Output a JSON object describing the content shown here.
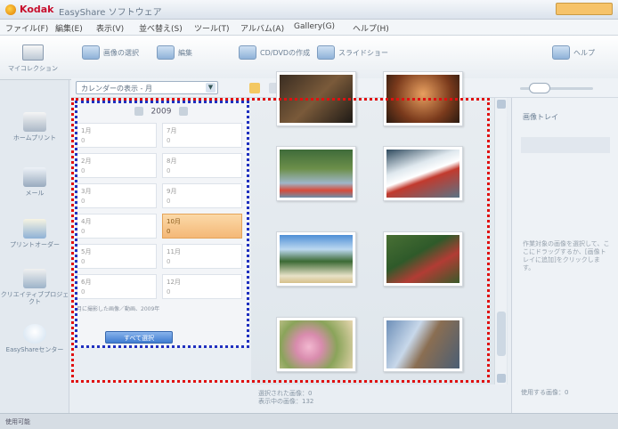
{
  "title_bar": {
    "brand": "Kodak",
    "app_title": "EasyShare ソフトウェア"
  },
  "menu": [
    "ファイル(F)",
    "編集(E)",
    "表示(V)",
    "並べ替え(S)",
    "ツール(T)",
    "アルバム(A)",
    "Gallery(G)",
    "ヘルプ(H)"
  ],
  "toolbar": {
    "select_photos": "画像の選択",
    "edit": "編集",
    "cd_dvd": "CD/DVDの作成",
    "slideshow": "スライドショー",
    "help": "ヘルプ",
    "collection": "マイコレクション"
  },
  "view_toolbar": {
    "dropdown_value": "カレンダーの表示 - 月"
  },
  "sidebar": {
    "items": [
      "ホームプリント",
      "メール",
      "プリントオーダー",
      "クリエイティブプロジェクト",
      "EasyShareセンター"
    ]
  },
  "calendar": {
    "year": "2009",
    "months": [
      {
        "label": "1月",
        "count": "0"
      },
      {
        "label": "7月",
        "count": "0"
      },
      {
        "label": "2月",
        "count": "0"
      },
      {
        "label": "8月",
        "count": "0"
      },
      {
        "label": "3月",
        "count": "0"
      },
      {
        "label": "9月",
        "count": "0"
      },
      {
        "label": "4月",
        "count": "0"
      },
      {
        "label": "10月",
        "count": "0"
      },
      {
        "label": "5月",
        "count": "0"
      },
      {
        "label": "11月",
        "count": "0"
      },
      {
        "label": "6月",
        "count": "0"
      },
      {
        "label": "12月",
        "count": "0"
      }
    ],
    "selected_month": "10月",
    "note": "月に撮影した画像／動画、2009年",
    "select_all_button": "すべて選択"
  },
  "photos_status": {
    "selected": "選択された画像：0",
    "in_view": "表示中の画像：132"
  },
  "tray": {
    "title": "画像トレイ",
    "message": "作業対象の画像を選択して、ここにドラッグするか、[画像トレイに追加]をクリックします。",
    "footer": "使用する画像：0"
  },
  "status_bar": "使用可能",
  "colors": {
    "red_outline": "#e01010",
    "blue_outline": "#1f2fbf",
    "selected_month_bg": "#f4b877"
  }
}
